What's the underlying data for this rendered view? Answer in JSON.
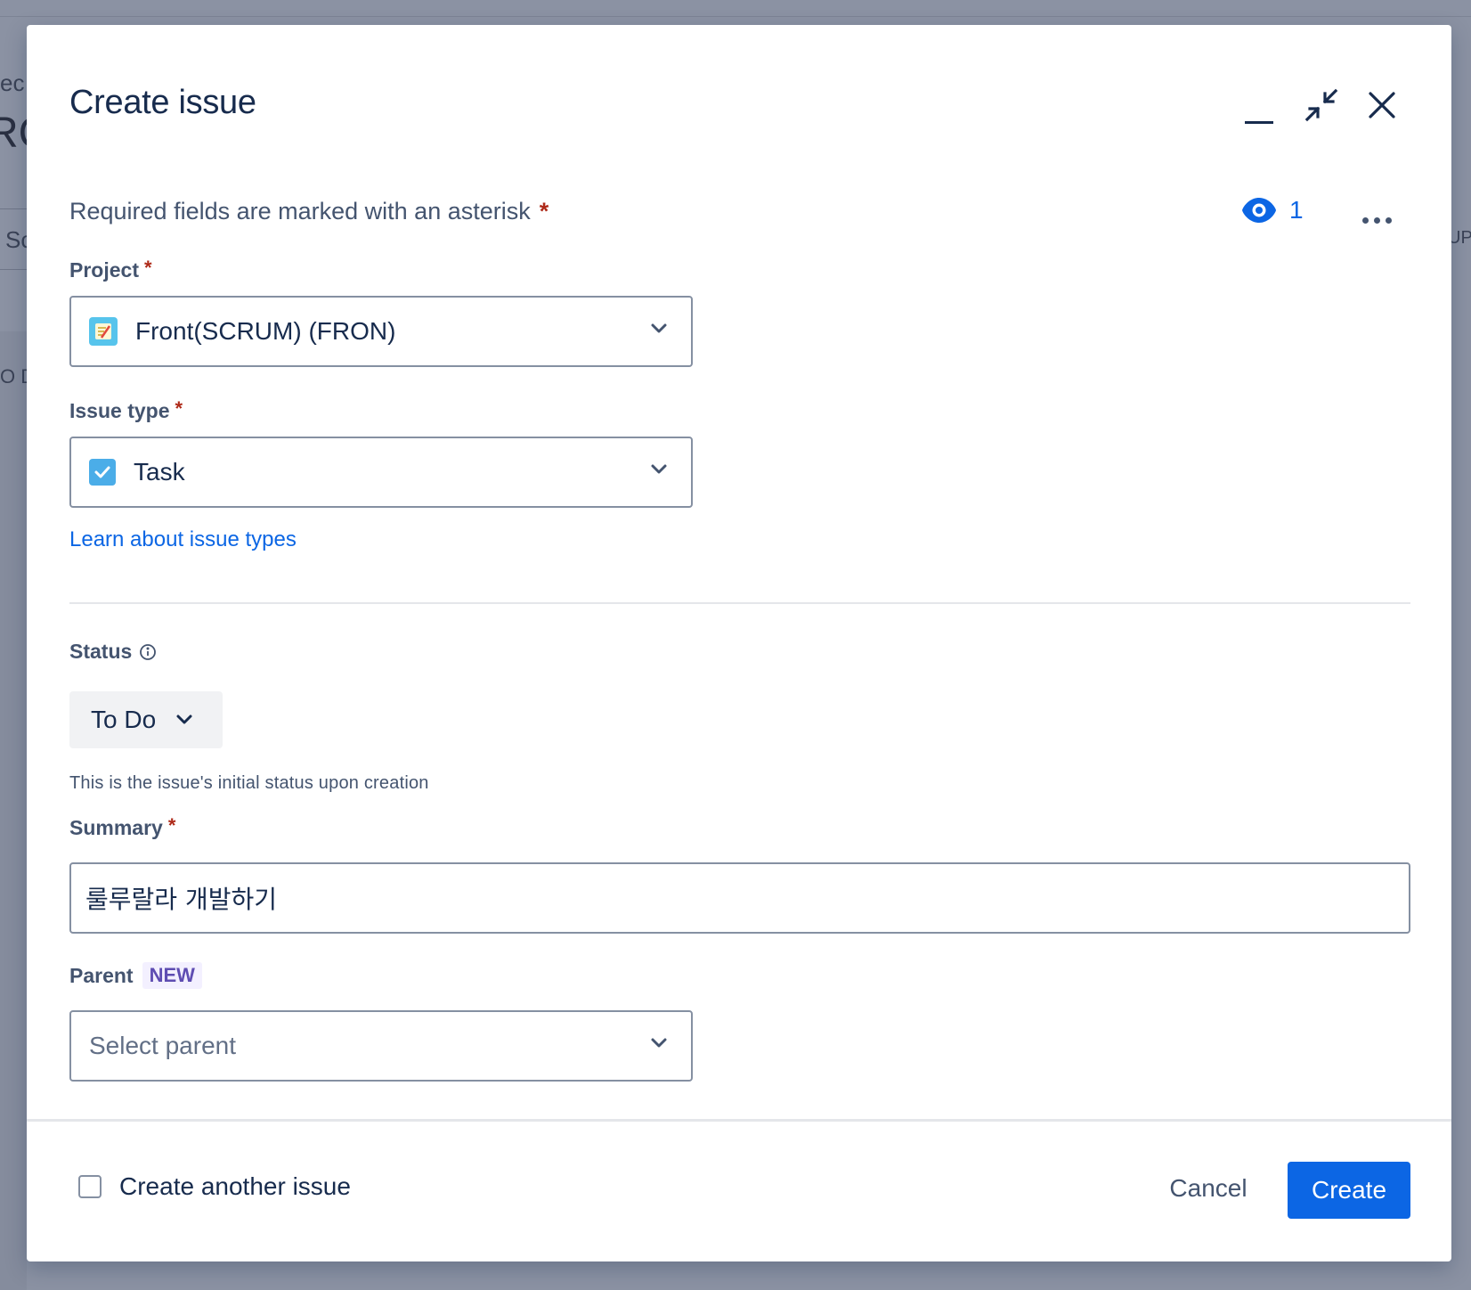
{
  "background": {
    "frag_top": "ec",
    "frag_big": "RC",
    "frag_tab": "Sc",
    "frag_col": "O D",
    "frag_right": "UP"
  },
  "modal": {
    "title": "Create issue",
    "required_note": "Required fields are marked with an asterisk",
    "required_marker": "*",
    "watchers_count": "1"
  },
  "fields": {
    "project": {
      "label": "Project",
      "value": "Front(SCRUM) (FRON)"
    },
    "issue_type": {
      "label": "Issue type",
      "value": "Task",
      "learn_link": "Learn about issue types"
    },
    "status": {
      "label": "Status",
      "value": "To Do",
      "helper": "This is the issue's initial status upon creation"
    },
    "summary": {
      "label": "Summary",
      "value": "룰루랄라 개발하기"
    },
    "parent": {
      "label": "Parent",
      "badge": "NEW",
      "placeholder": "Select parent"
    }
  },
  "footer": {
    "create_another_label": "Create another issue",
    "cancel_label": "Cancel",
    "create_label": "Create"
  },
  "colors": {
    "primary": "#0c66e4",
    "required": "#ae2a19",
    "text": "#172b4d",
    "subtle_text": "#44546f"
  }
}
